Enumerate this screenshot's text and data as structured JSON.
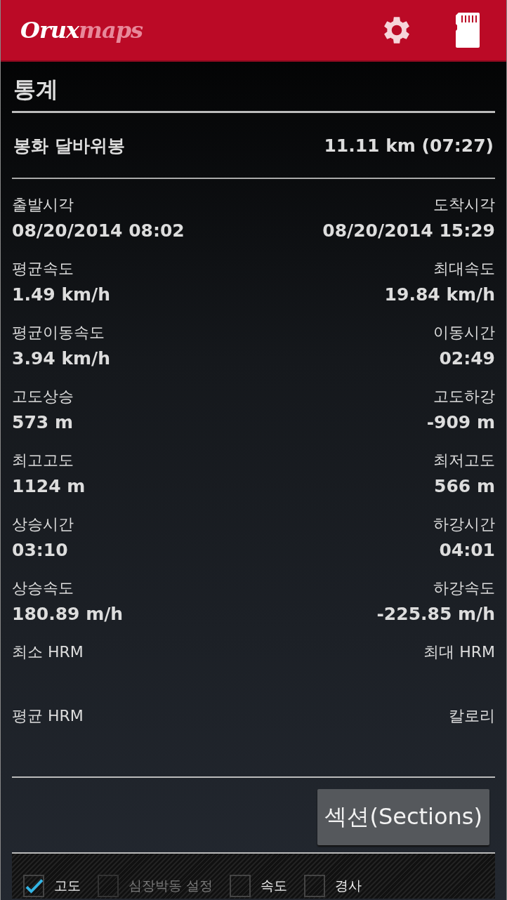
{
  "app_bar": {
    "logo": {
      "primary": "Orux",
      "secondary": "maps"
    }
  },
  "title": "통계",
  "summary": {
    "name": "봉화 달바위봉",
    "distance": "11.11 km (07:27)"
  },
  "stats": [
    {
      "left": {
        "label": "출발시각",
        "value": "08/20/2014 08:02"
      },
      "right": {
        "label": "도착시각",
        "value": "08/20/2014 15:29"
      }
    },
    {
      "left": {
        "label": "평균속도",
        "value": "1.49 km/h"
      },
      "right": {
        "label": "최대속도",
        "value": "19.84 km/h"
      }
    },
    {
      "left": {
        "label": "평균이동속도",
        "value": "3.94 km/h"
      },
      "right": {
        "label": "이동시간",
        "value": "02:49"
      }
    },
    {
      "left": {
        "label": "고도상승",
        "value": "573 m"
      },
      "right": {
        "label": "고도하강",
        "value": "-909 m"
      }
    },
    {
      "left": {
        "label": "최고고도",
        "value": "1124 m"
      },
      "right": {
        "label": "최저고도",
        "value": "566 m"
      }
    },
    {
      "left": {
        "label": "상승시간",
        "value": "03:10"
      },
      "right": {
        "label": "하강시간",
        "value": "04:01"
      }
    },
    {
      "left": {
        "label": "상승속도",
        "value": "180.89 m/h"
      },
      "right": {
        "label": "하강속도",
        "value": "-225.85 m/h"
      }
    },
    {
      "left": {
        "label": "최소 HRM"
      },
      "right": {
        "label": "최대 HRM"
      }
    },
    {
      "left": {
        "label": "평균 HRM"
      },
      "right": {
        "label": "칼로리"
      }
    }
  ],
  "sections_button": "섹션(Sections)",
  "chart_options": [
    {
      "label": "고도",
      "checked": true,
      "disabled": false
    },
    {
      "label": "심장박동 설정",
      "checked": false,
      "disabled": true
    },
    {
      "label": "속도",
      "checked": false,
      "disabled": false
    },
    {
      "label": "경사",
      "checked": false,
      "disabled": false
    }
  ]
}
